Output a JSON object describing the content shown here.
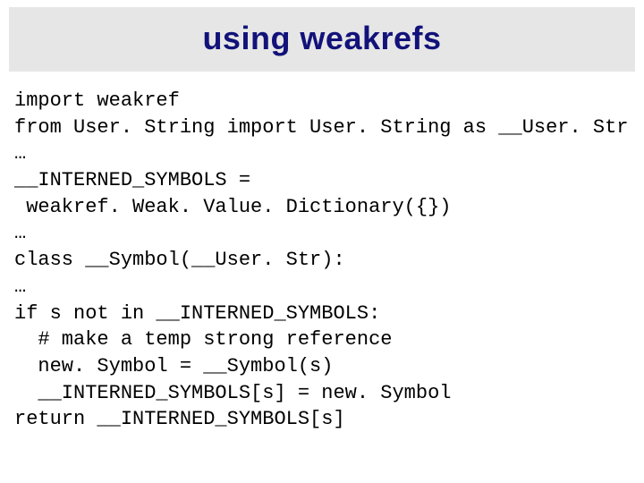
{
  "title": "using weakrefs",
  "code": {
    "l1": "import weakref",
    "l2": "from User. String import User. String as __User. Str",
    "l3": "…",
    "l4": "__INTERNED_SYMBOLS =",
    "l5": " weakref. Weak. Value. Dictionary({})",
    "l6": "…",
    "l7": "class __Symbol(__User. Str):",
    "l8": "…",
    "l9": "if s not in __INTERNED_SYMBOLS:",
    "l10": "  # make a temp strong reference",
    "l11": "  new. Symbol = __Symbol(s)",
    "l12": "  __INTERNED_SYMBOLS[s] = new. Symbol",
    "l13": "return __INTERNED_SYMBOLS[s]"
  }
}
